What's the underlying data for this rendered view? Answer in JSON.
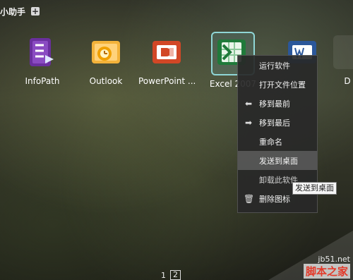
{
  "window": {
    "title": "小助手"
  },
  "apps": [
    {
      "name": "InfoPath"
    },
    {
      "name": "Outlook"
    },
    {
      "name": "PowerPoint ..."
    },
    {
      "name": "Excel 2007"
    },
    {
      "name": "..."
    },
    {
      "name": "D"
    }
  ],
  "context_menu": {
    "items": [
      {
        "label": "运行软件"
      },
      {
        "label": "打开文件位置"
      },
      {
        "label": "移到最前",
        "icon": "arrow-left-icon"
      },
      {
        "label": "移到最后",
        "icon": "arrow-right-icon"
      },
      {
        "label": "重命名"
      },
      {
        "label": "发送到桌面",
        "hovered": true
      },
      {
        "label": "卸载此软件"
      },
      {
        "label": "删除图标",
        "icon": "trash-icon"
      }
    ],
    "tooltip": "发送到桌面"
  },
  "pager": {
    "pages": [
      "1",
      "2"
    ],
    "active": "2"
  },
  "watermark": {
    "line1": "jb51.net",
    "line2": "脚本之家"
  },
  "colors": {
    "infopath": "#5b2a8a",
    "outlook": "#f0a000",
    "powerpoint": "#d24726",
    "excel": "#1f7a3a",
    "word": "#2b579a"
  }
}
